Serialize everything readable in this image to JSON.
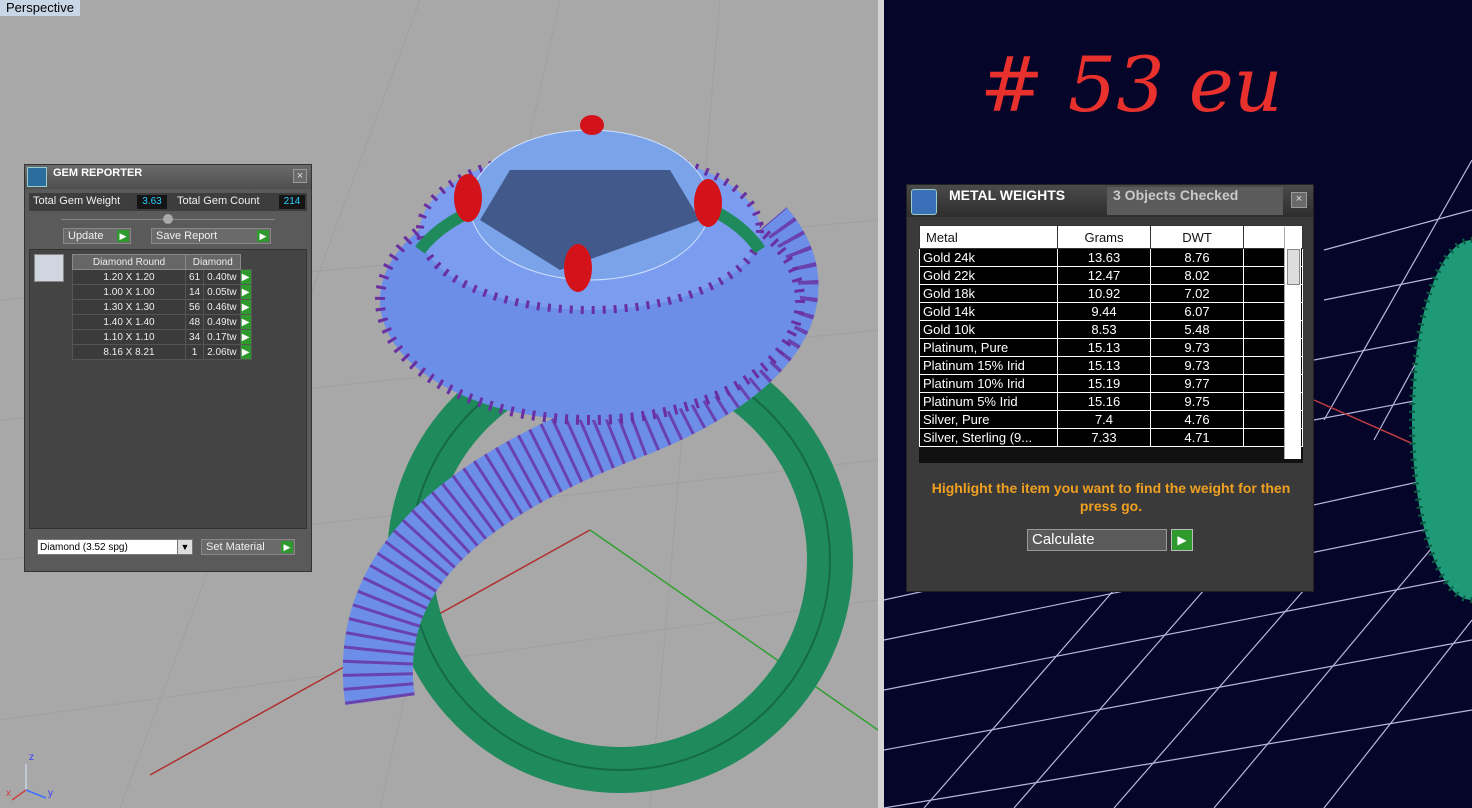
{
  "viewport": {
    "left_label": "Perspective"
  },
  "gem_reporter": {
    "title": "GEM REPORTER",
    "close": "×",
    "total_weight_label": "Total Gem Weight",
    "total_weight_value": "3.63",
    "total_count_label": "Total Gem Count",
    "total_count_value": "214",
    "update_label": "Update",
    "save_report_label": "Save Report",
    "table_headers": [
      "Diamond Round",
      "Diamond"
    ],
    "rows": [
      {
        "size": "1.20 X 1.20",
        "count": "61",
        "weight": "0.40tw"
      },
      {
        "size": "1.00 X 1.00",
        "count": "14",
        "weight": "0.05tw"
      },
      {
        "size": "1.30 X 1.30",
        "count": "56",
        "weight": "0.46tw"
      },
      {
        "size": "1.40 X 1.40",
        "count": "48",
        "weight": "0.49tw"
      },
      {
        "size": "1.10 X 1.10",
        "count": "34",
        "weight": "0.17tw"
      },
      {
        "size": "8.16 X 8.21",
        "count": "1",
        "weight": "2.06tw"
      }
    ],
    "material_select": "Diamond    (3.52 spg)",
    "set_material_label": "Set Material"
  },
  "metal_weights": {
    "title": "METAL WEIGHTS",
    "subtitle": "3 Objects Checked",
    "close": "×",
    "headers": [
      "Metal",
      "Grams",
      "DWT"
    ],
    "rows": [
      {
        "metal": "Gold 24k",
        "grams": "13.63",
        "dwt": "8.76"
      },
      {
        "metal": "Gold 22k",
        "grams": "12.47",
        "dwt": "8.02"
      },
      {
        "metal": "Gold 18k",
        "grams": "10.92",
        "dwt": "7.02"
      },
      {
        "metal": "Gold 14k",
        "grams": "9.44",
        "dwt": "6.07"
      },
      {
        "metal": "Gold 10k",
        "grams": "8.53",
        "dwt": "5.48"
      },
      {
        "metal": "Platinum, Pure",
        "grams": "15.13",
        "dwt": "9.73"
      },
      {
        "metal": "Platinum 15% Irid",
        "grams": "15.13",
        "dwt": "9.73"
      },
      {
        "metal": "Platinum 10% Irid",
        "grams": "15.19",
        "dwt": "9.77"
      },
      {
        "metal": "Platinum 5% Irid",
        "grams": "15.16",
        "dwt": "9.75"
      },
      {
        "metal": "Silver, Pure",
        "grams": "7.4",
        "dwt": "4.76"
      },
      {
        "metal": "Silver, Sterling (9...",
        "grams": "7.33",
        "dwt": "4.71"
      }
    ],
    "instruction": "Highlight the item you want to find the weight for then press go.",
    "calculate_label": "Calculate"
  },
  "annotation": {
    "handwritten": "# 53 eu"
  },
  "axes": {
    "z": "z",
    "x": "x",
    "y": "y"
  },
  "colors": {
    "ring_green": "#1f8a5c",
    "gem_blue": "#7aa6f0",
    "prong_red": "#d4121a",
    "accent_go": "#2e9a2e"
  }
}
